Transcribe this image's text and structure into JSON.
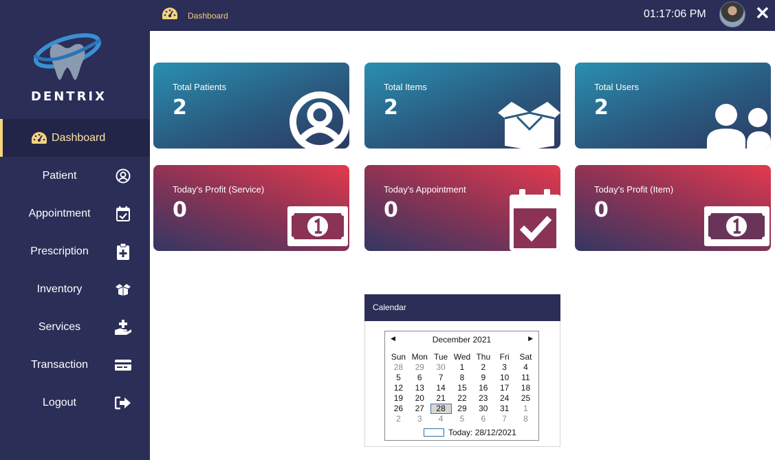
{
  "app": {
    "brand": "DENTRIX"
  },
  "topbar": {
    "breadcrumb": "Dashboard",
    "clock": "01:17:06 PM",
    "close_icon": "close-icon"
  },
  "sidebar": {
    "items": [
      {
        "label": "Dashboard",
        "icon": "speedometer-icon",
        "active": true
      },
      {
        "label": "Patient",
        "icon": "user-circle-icon"
      },
      {
        "label": "Appointment",
        "icon": "calendar-check-icon"
      },
      {
        "label": "Prescription",
        "icon": "clipboard-plus-icon"
      },
      {
        "label": "Inventory",
        "icon": "box-open-icon"
      },
      {
        "label": "Services",
        "icon": "hand-plus-icon"
      },
      {
        "label": "Transaction",
        "icon": "credit-card-icon"
      },
      {
        "label": "Logout",
        "icon": "sign-out-icon"
      }
    ]
  },
  "cards": [
    {
      "title": "Total Patients",
      "value": "2",
      "icon": "user-circle-icon"
    },
    {
      "title": "Total Items",
      "value": "2",
      "icon": "box-open-icon"
    },
    {
      "title": "Total Users",
      "value": "2",
      "icon": "users-icon"
    },
    {
      "title": "Today's Profit (Service)",
      "value": "0",
      "icon": "money-bill-icon"
    },
    {
      "title": "Today's Appointment",
      "value": "0",
      "icon": "calendar-check-icon"
    },
    {
      "title": "Today's Profit (Item)",
      "value": "0",
      "icon": "money-bill-icon"
    }
  ],
  "calendar": {
    "header": "Calendar",
    "month_label": "December 2021",
    "days_of_week": [
      "Sun",
      "Mon",
      "Tue",
      "Wed",
      "Thu",
      "Fri",
      "Sat"
    ],
    "weeks": [
      [
        "28",
        "29",
        "30",
        "1",
        "2",
        "3",
        "4"
      ],
      [
        "5",
        "6",
        "7",
        "8",
        "9",
        "10",
        "11"
      ],
      [
        "12",
        "13",
        "14",
        "15",
        "16",
        "17",
        "18"
      ],
      [
        "19",
        "20",
        "21",
        "22",
        "23",
        "24",
        "25"
      ],
      [
        "26",
        "27",
        "28",
        "29",
        "30",
        "31",
        "1"
      ],
      [
        "2",
        "3",
        "4",
        "5",
        "6",
        "7",
        "8"
      ]
    ],
    "selected": "28",
    "today_label": "Today: 28/12/2021"
  },
  "colors": {
    "sidebar": "#2b2e57",
    "accent": "#f5d47f",
    "card_blue": "#2a8fb1",
    "card_red": "#e33a4e"
  }
}
